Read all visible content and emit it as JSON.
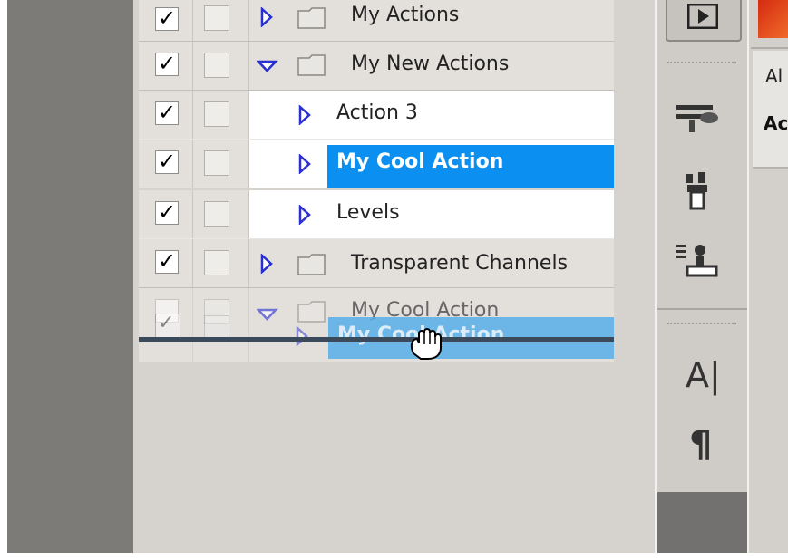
{
  "actions_panel": {
    "rows": [
      {
        "label": "My Actions",
        "type": "set",
        "expanded": false,
        "checked": true
      },
      {
        "label": "My New Actions",
        "type": "set",
        "expanded": true,
        "checked": true
      },
      {
        "label": "Action 3",
        "type": "action",
        "checked": true
      },
      {
        "label": "My Cool Action",
        "type": "action",
        "selected": true,
        "checked": true
      },
      {
        "label": "Levels",
        "type": "action",
        "checked": true
      },
      {
        "label": "Transparent Channels",
        "type": "set",
        "expanded": false,
        "checked": true
      },
      {
        "label": "My Cool Action",
        "type": "set",
        "expanded": true,
        "checked": false
      }
    ],
    "drag_ghost_label": "My Cool Action"
  },
  "side_panel": {
    "tab_1": "Al",
    "tab_2": "Ac"
  },
  "toolbar_icons": [
    "play-icon",
    "brushes-icon",
    "clone-source-icon",
    "tool-presets-icon",
    "character-icon",
    "paragraph-icon"
  ],
  "colors": {
    "selection": "#0b90f1",
    "panel": "#d6d3cf",
    "triangle": "#2a2fd1"
  }
}
